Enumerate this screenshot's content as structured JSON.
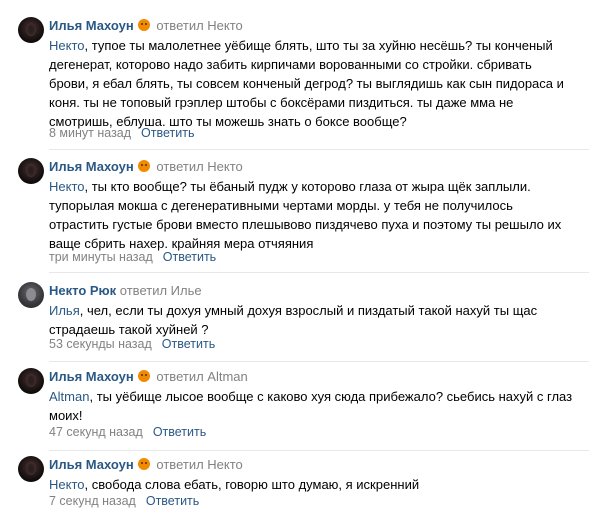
{
  "reply_label": "Ответить",
  "comments": [
    {
      "author": "Илья Махоун",
      "replied": "ответил",
      "replied_to": "Некто",
      "mention": "Некто",
      "lines": [
        ", тупое ты малолетнее уёбище блять, што ты за хуйню несёшь? ты конченый",
        "дегенерат, которово надо забить кирпичами ворованными со стройки. сбривать",
        "брови, я ебал блять, ты совсем конченый дегрод? ты выглядишь как сын пидораса и",
        "коня. ты не топовый грэплер штобы с боксёрами пиздиться. ты даже мма не",
        "смотришь, еблуша. што ты можешь знать о боксе вообще?"
      ],
      "time": "8 минут назад"
    },
    {
      "author": "Илья Махоун",
      "replied": "ответил",
      "replied_to": "Некто",
      "mention": "Некто",
      "lines": [
        ", ты кто вообще? ты ёбаный пудж у которово глаза от жыра щёк заплыли.",
        "тупорылая мокша с дегенеративными чертами морды. у тебя не получилось",
        "отрастить густые брови вместо плешывово пиздячево пуха и поэтому ты решыло их",
        "ваще сбрить нахер. крайняя мера отчяяния"
      ],
      "time": "три минуты назад"
    },
    {
      "author": "Некто Рюк",
      "replied": "ответил",
      "replied_to": "Илье",
      "mention": "Илья",
      "lines": [
        ", чел, если ты дохуя умный дохуя взрослый и пиздатый такой нахуй ты щас",
        "страдаешь такой хуйней ?"
      ],
      "time": "53 секунды назад"
    },
    {
      "author": "Илья Махоун",
      "replied": "ответил",
      "replied_to": "Altman",
      "mention": "Altman",
      "lines": [
        ", ты уёбище лысое вообще с каково хуя сюда прибежало? сьебись нахуй с глаз",
        "моих!"
      ],
      "time": "47 секунд назад"
    },
    {
      "author": "Илья Махоун",
      "replied": "ответил",
      "replied_to": "Некто",
      "mention": "Некто",
      "lines": [
        ", свобода слова ебать, говорю што думаю, я искренний"
      ],
      "time": "7 секунд назад"
    }
  ]
}
